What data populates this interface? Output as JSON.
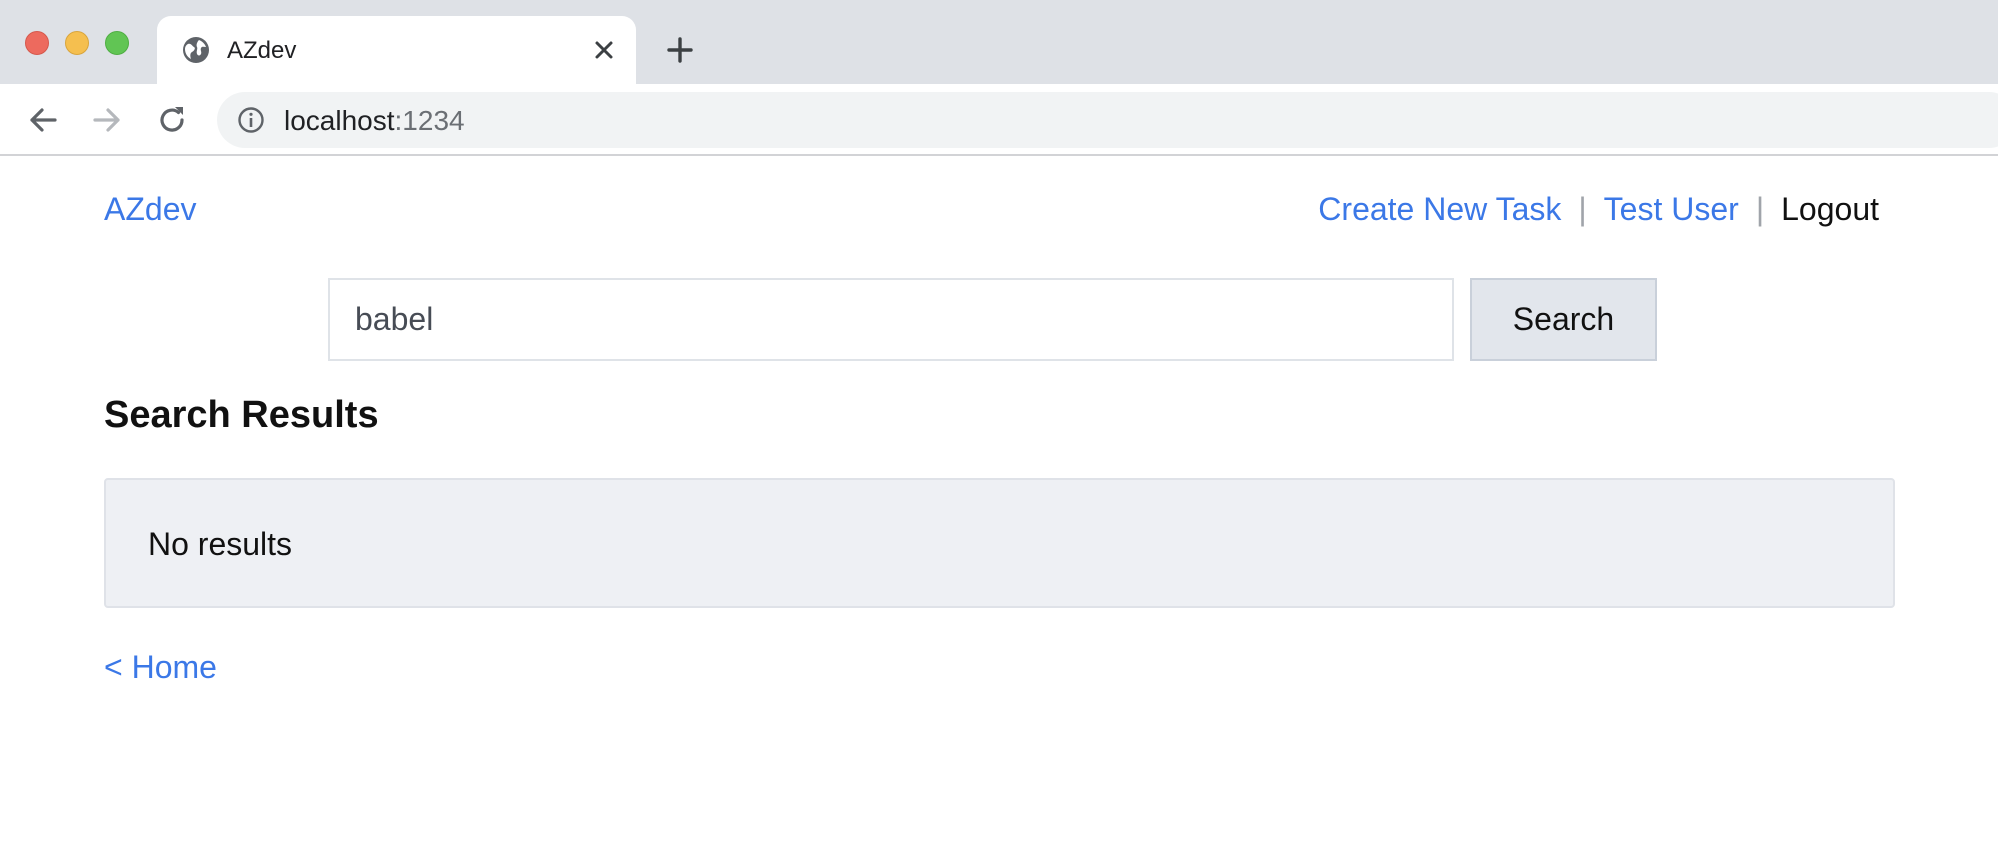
{
  "browser": {
    "tab": {
      "title": "AZdev",
      "favicon": "globe-icon"
    },
    "address_bar": {
      "host": "localhost",
      "port": ":1234"
    },
    "icons": {
      "back": "arrow-left-icon",
      "forward": "arrow-right-icon",
      "reload": "reload-icon",
      "info": "info-icon",
      "close": "close-icon",
      "new_tab": "plus-icon"
    }
  },
  "header": {
    "brand": "AZdev",
    "nav": {
      "create_task": "Create New Task",
      "separator": "|",
      "user": "Test User",
      "logout": "Logout"
    }
  },
  "search": {
    "value": "babel",
    "button_label": "Search"
  },
  "results": {
    "heading": "Search Results",
    "empty_message": "No results"
  },
  "footer": {
    "home_link": "< Home"
  },
  "colors": {
    "link": "#3b78e7",
    "results_bg": "#eef0f4",
    "button_bg": "#e2e6ec"
  }
}
